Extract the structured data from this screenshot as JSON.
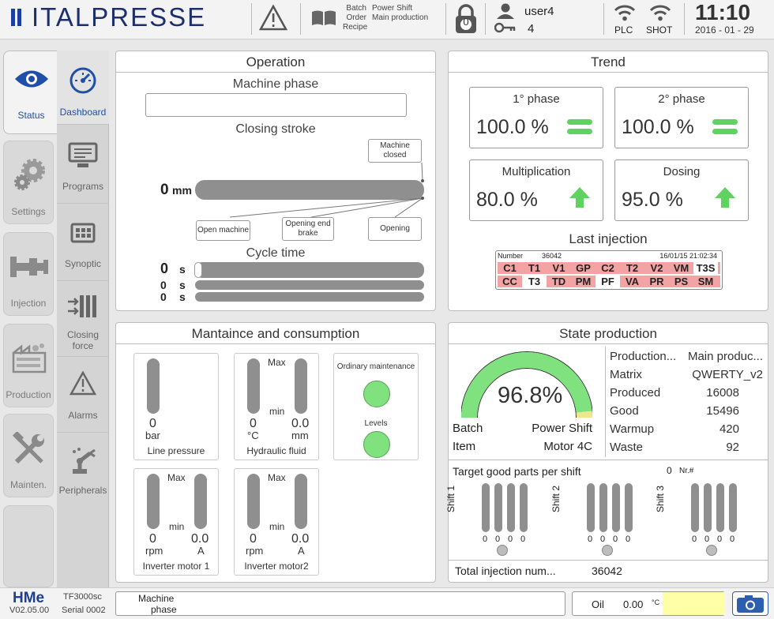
{
  "header": {
    "brand": "ITALPRESSE",
    "info_labels": [
      "Batch",
      "Order",
      "Recipe"
    ],
    "info_values": [
      "Power Shift",
      "Main production"
    ],
    "lock_count": "0",
    "user_name": "user4",
    "user_count": "4",
    "plc_label": "PLC",
    "shot_label": "SHOT",
    "time": "11:10",
    "date": "2016 - 01 - 29"
  },
  "nav_main": [
    {
      "label": "Status",
      "icon": "eye-icon",
      "active": true
    },
    {
      "label": "Settings",
      "icon": "gears-icon"
    },
    {
      "label": "Injection",
      "icon": "injection-icon"
    },
    {
      "label": "Production",
      "icon": "factory-icon"
    },
    {
      "label": "Mainten.",
      "icon": "tools-icon"
    }
  ],
  "nav_sub": [
    {
      "label": "Dashboard",
      "icon": "speedometer-icon",
      "active": true
    },
    {
      "label": "Programs",
      "icon": "monitor-icon"
    },
    {
      "label": "Synoptic",
      "icon": "grid-icon"
    },
    {
      "label": "Closing force",
      "icon": "closing-force-icon"
    },
    {
      "label": "Alarms",
      "icon": "warning-icon"
    },
    {
      "label": "Peripherals",
      "icon": "robot-arm-icon"
    }
  ],
  "operation": {
    "title": "Operation",
    "machine_phase_label": "Machine phase",
    "machine_phase_value": "",
    "closing_stroke_label": "Closing stroke",
    "stroke_value": "0",
    "stroke_unit": "mm",
    "callouts": {
      "machine_closed": "Machine closed",
      "open_machine": "Open machine",
      "opening_end_brake": "Opening end brake",
      "opening": "Opening"
    },
    "cycle_time_label": "Cycle time",
    "cycle_times": [
      {
        "value": "0",
        "unit": "s"
      },
      {
        "value": "0",
        "unit": "s"
      },
      {
        "value": "0",
        "unit": "s"
      }
    ]
  },
  "trend": {
    "title": "Trend",
    "boxes": [
      {
        "title": "1° phase",
        "value": "100.0 %",
        "indicator": "equal-icon"
      },
      {
        "title": "2° phase",
        "value": "100.0 %",
        "indicator": "equal-icon"
      },
      {
        "title": "Multiplication",
        "value": "80.0 %",
        "indicator": "arrow-up-icon"
      },
      {
        "title": "Dosing",
        "value": "95.0 %",
        "indicator": "arrow-up-icon"
      }
    ],
    "last_injection_label": "Last injection",
    "injection_number_label": "Number",
    "injection_number": "36042",
    "injection_datetime": "16/01/15 21:02:34",
    "row1": [
      {
        "t": "C1",
        "bg": "#f3a3a3"
      },
      {
        "t": "T1",
        "bg": "#f3a3a3"
      },
      {
        "t": "V1",
        "bg": "#f3a3a3"
      },
      {
        "t": "GP",
        "bg": "#f3a3a3"
      },
      {
        "t": "C2",
        "bg": "#f3a3a3"
      },
      {
        "t": "T2",
        "bg": "#f3a3a3"
      },
      {
        "t": "V2",
        "bg": "#f3a3a3"
      },
      {
        "t": "VM",
        "bg": "#f3a3a3"
      },
      {
        "t": "T3S",
        "bg": "#ffffff"
      }
    ],
    "row2": [
      {
        "t": "CC",
        "bg": "#f3a3a3"
      },
      {
        "t": "T3",
        "bg": "#ffffff"
      },
      {
        "t": "TD",
        "bg": "#f3a3a3"
      },
      {
        "t": "PM",
        "bg": "#f3a3a3"
      },
      {
        "t": "PF",
        "bg": "#ffffff"
      },
      {
        "t": "VA",
        "bg": "#f3a3a3"
      },
      {
        "t": "PR",
        "bg": "#f3a3a3"
      },
      {
        "t": "PS",
        "bg": "#f3a3a3"
      },
      {
        "t": "SM",
        "bg": "#f3a3a3"
      }
    ]
  },
  "maintenance": {
    "title": "Mantaince and consumption",
    "line_pressure": {
      "value": "0",
      "unit": "bar",
      "label": "Line pressure"
    },
    "hydraulic": {
      "max_label": "Max",
      "min_label": "min",
      "temp_value": "0",
      "temp_unit": "°C",
      "level_value": "0.0",
      "level_unit": "mm",
      "label": "Hydraulic fluid"
    },
    "ordinary_maintenance_label": "Ordinary maintenance",
    "levels_label": "Levels",
    "inverter1": {
      "max_label": "Max",
      "min_label": "min",
      "rpm_value": "0",
      "rpm_unit": "rpm",
      "amp_value": "0.0",
      "amp_unit": "A",
      "label": "Inverter motor 1"
    },
    "inverter2": {
      "max_label": "Max",
      "min_label": "min",
      "rpm_value": "0",
      "rpm_unit": "rpm",
      "amp_value": "0.0",
      "amp_unit": "A",
      "label": "Inverter motor2"
    }
  },
  "state_production": {
    "title": "State production",
    "gauge_value": "96.8%",
    "gauge_fraction": 0.968,
    "batch_label": "Batch",
    "batch_value": "Power Shift",
    "item_label": "Item",
    "item_value": "Motor 4C",
    "rows": [
      {
        "k": "Production...",
        "v": "Main produc..."
      },
      {
        "k": "Matrix",
        "v": "QWERTY_v2"
      },
      {
        "k": "Produced",
        "v": "16008"
      },
      {
        "k": "Good",
        "v": "15496"
      },
      {
        "k": "Warmup",
        "v": "420"
      },
      {
        "k": "Waste",
        "v": "92"
      }
    ],
    "target_label": "Target good parts per shift",
    "target_count": "0",
    "target_unit": "Nr.#",
    "shifts": [
      {
        "label": "Shift 1",
        "values": [
          "0",
          "0",
          "0",
          "0"
        ]
      },
      {
        "label": "Shift 2",
        "values": [
          "0",
          "0",
          "0",
          "0"
        ]
      },
      {
        "label": "Shift 3",
        "values": [
          "0",
          "0",
          "0",
          "0"
        ]
      }
    ],
    "total_label": "Total injection num...",
    "total_value": "36042"
  },
  "footer": {
    "hme_logo": "HMe",
    "version": "V02.05.00",
    "model": "TF3000sc",
    "serial": "Serial 0002",
    "phase_label_1": "Machine",
    "phase_label_2": "phase",
    "oil_label": "Oil",
    "oil_value": "0.00",
    "oil_unit": "°C"
  },
  "colors": {
    "brand": "#1e2f6e",
    "accent": "#1f4fa8",
    "green": "#7fe27f",
    "bar": "#8f8f8f",
    "injection_red": "#f3a3a3"
  }
}
